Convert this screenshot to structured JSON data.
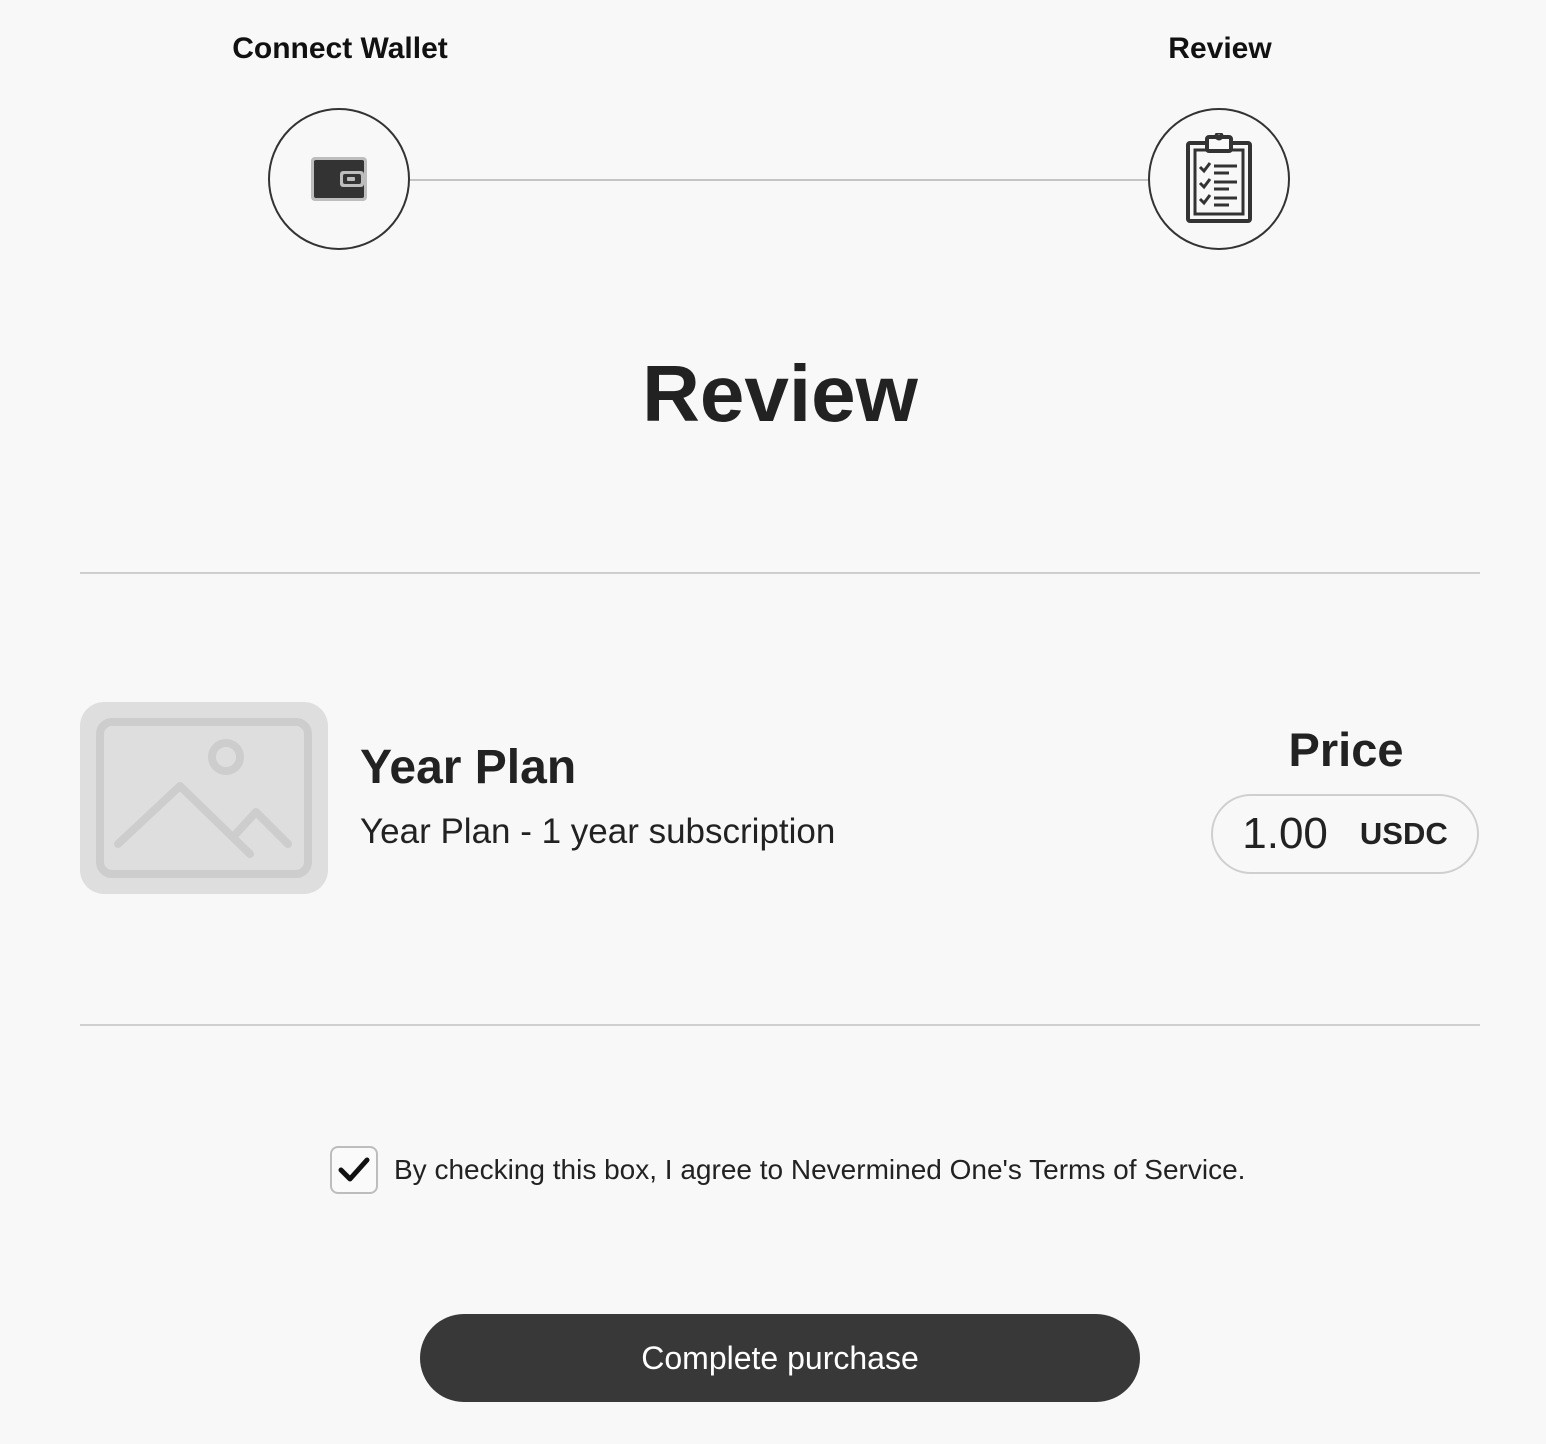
{
  "stepper": {
    "steps": [
      {
        "label": "Connect Wallet",
        "icon": "wallet-icon"
      },
      {
        "label": "Review",
        "icon": "clipboard-checklist-icon"
      }
    ]
  },
  "page": {
    "title": "Review"
  },
  "item": {
    "image_icon": "image-placeholder-icon",
    "name": "Year Plan",
    "description": "Year Plan - 1 year subscription"
  },
  "price": {
    "label": "Price",
    "value": "1.00",
    "currency": "USDC"
  },
  "terms": {
    "checked": true,
    "text": "By checking this box, I agree to Nevermined One's Terms of Service."
  },
  "actions": {
    "complete_label": "Complete purchase"
  },
  "colors": {
    "background": "#f8f8f8",
    "button": "#383838",
    "divider": "#cfcfcf",
    "placeholder": "#dedede"
  }
}
